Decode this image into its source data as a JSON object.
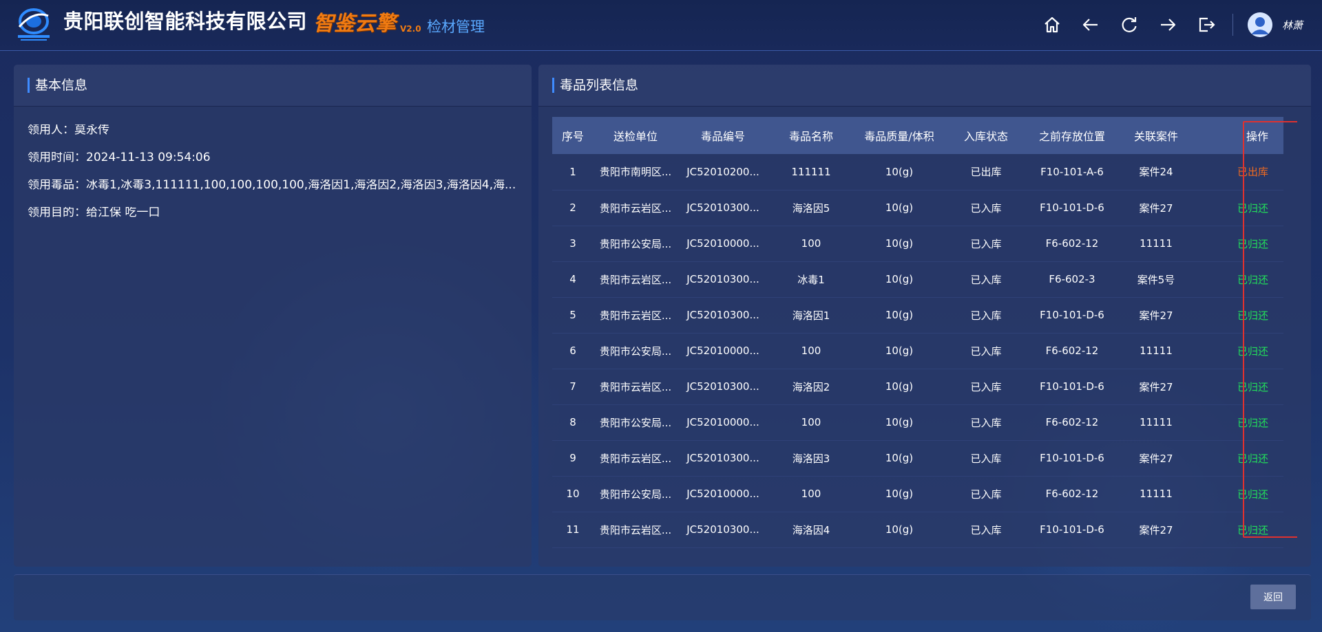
{
  "header": {
    "company": "贵阳联创智能科技有限公司",
    "product": "智鉴云擎",
    "version": "V2.0",
    "module": "检材管理",
    "username": "林萧",
    "icons": [
      "home-icon",
      "back-arrow-icon",
      "refresh-icon",
      "forward-arrow-icon",
      "logout-icon"
    ]
  },
  "left_panel": {
    "title": "基本信息",
    "recipient_label": "领用人：",
    "recipient": "莫永传",
    "time_label": "领用时间：",
    "time": "2024-11-13 09:54:06",
    "drugs_label": "领用毒品：",
    "drugs": "冰毒1,冰毒3,111111,100,100,100,100,海洛因1,海洛因2,海洛因3,海洛因4,海...",
    "purpose_label": "领用目的：",
    "purpose": "给江保 吃一口"
  },
  "right_panel": {
    "title": "毒品列表信息",
    "columns": [
      "序号",
      "送检单位",
      "毒品编号",
      "毒品名称",
      "毒品质量/体积",
      "入库状态",
      "之前存放位置",
      "关联案件",
      "操作"
    ],
    "rows": [
      [
        "1",
        "贵阳市南明区...",
        "JC52010200...",
        "111111",
        "10(g)",
        "已出库",
        "F10-101-A-6",
        "案件24",
        "已出库"
      ],
      [
        "2",
        "贵阳市云岩区...",
        "JC52010300...",
        "海洛因5",
        "10(g)",
        "已入库",
        "F10-101-D-6",
        "案件27",
        "已归还"
      ],
      [
        "3",
        "贵阳市公安局...",
        "JC52010000...",
        "100",
        "10(g)",
        "已入库",
        "F6-602-12",
        "11111",
        "已归还"
      ],
      [
        "4",
        "贵阳市云岩区...",
        "JC52010300...",
        "冰毒1",
        "10(g)",
        "已入库",
        "F6-602-3",
        "案件5号",
        "已归还"
      ],
      [
        "5",
        "贵阳市云岩区...",
        "JC52010300...",
        "海洛因1",
        "10(g)",
        "已入库",
        "F10-101-D-6",
        "案件27",
        "已归还"
      ],
      [
        "6",
        "贵阳市公安局...",
        "JC52010000...",
        "100",
        "10(g)",
        "已入库",
        "F6-602-12",
        "11111",
        "已归还"
      ],
      [
        "7",
        "贵阳市云岩区...",
        "JC52010300...",
        "海洛因2",
        "10(g)",
        "已入库",
        "F10-101-D-6",
        "案件27",
        "已归还"
      ],
      [
        "8",
        "贵阳市公安局...",
        "JC52010000...",
        "100",
        "10(g)",
        "已入库",
        "F6-602-12",
        "11111",
        "已归还"
      ],
      [
        "9",
        "贵阳市云岩区...",
        "JC52010300...",
        "海洛因3",
        "10(g)",
        "已入库",
        "F10-101-D-6",
        "案件27",
        "已归还"
      ],
      [
        "10",
        "贵阳市公安局...",
        "JC52010000...",
        "100",
        "10(g)",
        "已入库",
        "F6-602-12",
        "11111",
        "已归还"
      ],
      [
        "11",
        "贵阳市云岩区...",
        "JC52010300...",
        "海洛因4",
        "10(g)",
        "已入库",
        "F10-101-D-6",
        "案件27",
        "已归还"
      ]
    ]
  },
  "footer": {
    "back_label": "返回"
  },
  "colors": {
    "op_out": "#f06a20",
    "op_returned": "#22e05a",
    "highlight": "#e0312f",
    "module": "#5aa9ff",
    "product": "#f07b12"
  }
}
